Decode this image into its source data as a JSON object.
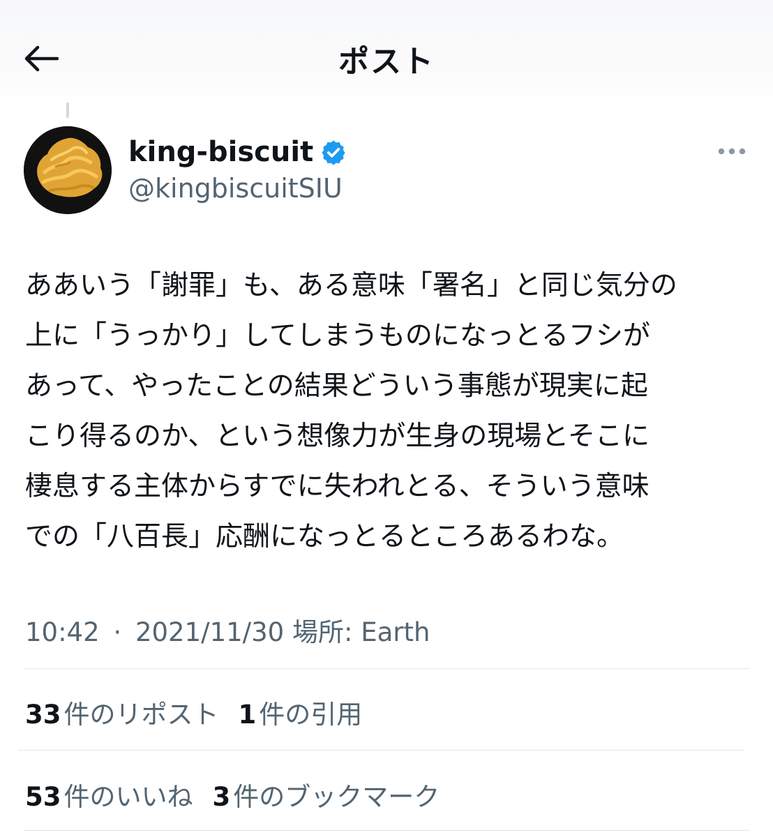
{
  "header": {
    "title": "ポスト"
  },
  "author": {
    "display_name": "king-biscuit",
    "handle": "@kingbiscuitSIU",
    "verified": true
  },
  "tweet": {
    "lines": [
      "ああいう「謝罪」も、ある意味「署名」と同じ気分の",
      "上に「うっかり」してしまうものになっとるフシが",
      "あって、やったことの結果どういう事態が現実に起",
      "こり得るのか、という想像力が生身の現場とそこに",
      "棲息する主体からすでに失われとる、そういう意味",
      "での「八百長」応酬になっとるところあるわな。"
    ]
  },
  "meta": {
    "time": "10:42",
    "separator": "·",
    "date": "2021/11/30",
    "location_label": "場所:",
    "location": "Earth"
  },
  "stats": {
    "reposts_count": "33",
    "reposts_label": "件のリポスト",
    "quotes_count": "1",
    "quotes_label": "件の引用",
    "likes_count": "53",
    "likes_label": "件のいいね",
    "bookmarks_count": "3",
    "bookmarks_label": "件のブックマーク"
  },
  "colors": {
    "text_primary": "#0f1419",
    "text_secondary": "#536471",
    "verified_blue": "#1d9bf0",
    "divider": "#e1e6ea"
  },
  "icons": {
    "back": "back-arrow-icon",
    "verified": "verified-badge-icon",
    "more": "more-dots-icon"
  }
}
